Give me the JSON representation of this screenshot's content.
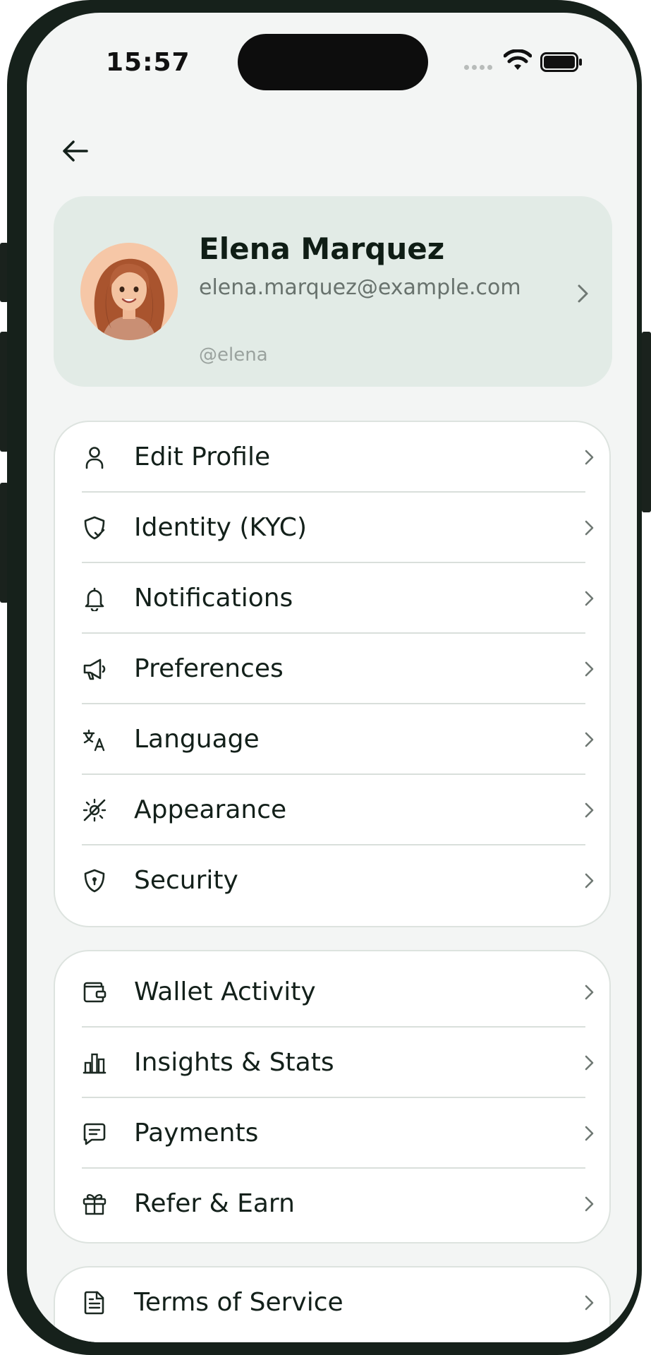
{
  "status_bar": {
    "time": "15:57"
  },
  "profile": {
    "name": "Elena Marquez",
    "email": "elena.marquez@example.com",
    "handle": "@elena"
  },
  "menu_group_1": [
    {
      "label": "Edit Profile",
      "icon": "user-icon"
    },
    {
      "label": "Identity (KYC)",
      "icon": "shield-check-icon"
    },
    {
      "label": "Notifications",
      "icon": "bell-icon"
    },
    {
      "label": "Preferences",
      "icon": "megaphone-icon"
    },
    {
      "label": "Language",
      "icon": "translate-icon"
    },
    {
      "label": "Appearance",
      "icon": "sun-off-icon"
    },
    {
      "label": "Security",
      "icon": "shield-lock-icon"
    }
  ],
  "menu_group_2": [
    {
      "label": "Wallet Activity",
      "icon": "wallet-icon"
    },
    {
      "label": "Insights & Stats",
      "icon": "bar-chart-icon"
    },
    {
      "label": "Payments",
      "icon": "message-icon"
    },
    {
      "label": "Refer & Earn",
      "icon": "gift-icon"
    }
  ],
  "menu_group_3": [
    {
      "label": "Terms of Service",
      "icon": "document-icon"
    }
  ]
}
